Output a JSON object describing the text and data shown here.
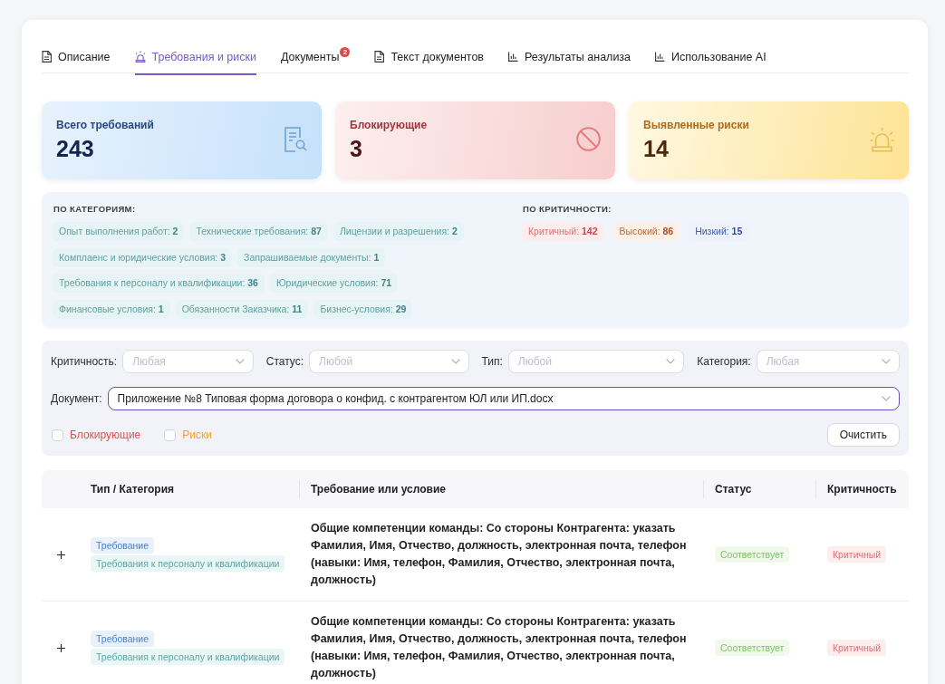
{
  "tabs": [
    {
      "label": "Описание",
      "kind": "document",
      "selected": false
    },
    {
      "label": "Требования и риски",
      "kind": "alert",
      "selected": true
    },
    {
      "label": "Документы",
      "kind": "plain",
      "selected": false,
      "badge": "2"
    },
    {
      "label": "Текст документов",
      "kind": "document",
      "selected": false
    },
    {
      "label": "Результаты анализа",
      "kind": "chart",
      "selected": false
    },
    {
      "label": "Использование AI",
      "kind": "chart",
      "selected": false
    }
  ],
  "stats": [
    {
      "label": "Всего требований",
      "value": "243",
      "kind": "total"
    },
    {
      "label": "Блокирующие",
      "value": "3",
      "kind": "blocking"
    },
    {
      "label": "Выявленные риски",
      "value": "14",
      "kind": "risks"
    }
  ],
  "summary": {
    "categories": {
      "title": "ПО КАТЕГОРИЯМ:",
      "rows": [
        {
          "chips": [
            "Опыт выполнения работ: **2**",
            "Технические требования: **87**",
            "Лицензии и разрешения: **2**"
          ]
        },
        {
          "chips": [
            "Комплаенс и юридические условия: **3**",
            "Запрашиваемые документы: **1**"
          ]
        },
        {
          "chips": [
            "Требования к персоналу и квалификации: **36**",
            "Юридические условия: **71**"
          ]
        },
        {
          "chips": [
            "Финансовые условия: **1**",
            "Обязанности Заказчика: **11**",
            "Бизнес-условия: **29**"
          ]
        }
      ]
    },
    "criticality": {
      "title": "ПО КРИТИЧНОСТИ:",
      "chips": [
        {
          "text": "Критичный: **142**",
          "kind": "critical"
        },
        {
          "text": "Высокий: **86**",
          "kind": "high"
        },
        {
          "text": "Низкий: **15**",
          "kind": "low"
        }
      ]
    }
  },
  "filters": {
    "selects": [
      {
        "label": "Критичность:",
        "placeholder": "Любая",
        "focused": false
      },
      {
        "label": "Статус:",
        "placeholder": "Любой",
        "focused": false
      },
      {
        "label": "Тип:",
        "placeholder": "Любой",
        "focused": false
      },
      {
        "label": "Категория:",
        "placeholder": "Любая",
        "focused": false
      }
    ],
    "document": {
      "label": "Документ:",
      "value": "Приложение №8 Типовая форма договора о конфид. с контрагентом ЮЛ или ИП.docx",
      "focused": true
    },
    "checkboxes": [
      {
        "label": "Блокирующие",
        "kind": "blocking",
        "checked": false
      },
      {
        "label": "Риски",
        "kind": "risks",
        "checked": false
      }
    ],
    "clear_button": "Очистить"
  },
  "table": {
    "columns": [
      "Тип / Категория",
      "Требование или условие",
      "Статус",
      "Критичность"
    ],
    "rows": [
      {
        "expanded": false,
        "type": "Требование",
        "category": "Требования к персоналу и квалификации",
        "requirement": "Общие компетенции команды: Со стороны Контрагента: указать Фамилия, Имя, Отчество, должность, электронная почта, телефон (навыки: Имя, телефон, Фамилия, Отчество, электронная почта, должность)",
        "status": {
          "label": "Соответствует",
          "kind": "match"
        },
        "criticality": {
          "label": "Критичный",
          "kind": "critical"
        }
      },
      {
        "expanded": false,
        "type": "Требование",
        "category": "Требования к персоналу и квалификации",
        "requirement": "Общие компетенции команды: Со стороны Контрагента: указать Фамилия, Имя, Отчество, должность, электронная почта, телефон (навыки: Имя, телефон, Фамилия, Отчество, электронная почта, должность)",
        "status": {
          "label": "Соответствует",
          "kind": "match"
        },
        "criticality": {
          "label": "Критичный",
          "kind": "critical"
        }
      }
    ]
  }
}
